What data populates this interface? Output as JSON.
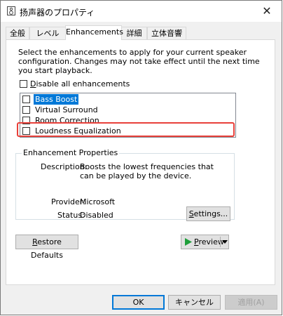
{
  "window": {
    "title": "扬声器のプロパティ",
    "close_glyph": "✕"
  },
  "tabs": [
    {
      "label": "全般"
    },
    {
      "label": "レベル"
    },
    {
      "label": "Enhancements"
    },
    {
      "label": "詳細"
    },
    {
      "label": "立体音響"
    }
  ],
  "active_tab": "Enhancements",
  "enhancements": {
    "description": "Select the enhancements to apply for your current speaker configuration. Changes may not take effect until the next time you start playback.",
    "disable_all_label": "Disable all enhancements",
    "disable_all_checked": false,
    "items": [
      {
        "label": "Bass Boost",
        "checked": false,
        "selected": true
      },
      {
        "label": "Virtual Surround",
        "checked": false,
        "selected": false
      },
      {
        "label": "Room Correction",
        "checked": false,
        "selected": false
      },
      {
        "label": "Loudness Equalization",
        "checked": false,
        "selected": false
      }
    ],
    "highlighted_item": "Loudness Equalization",
    "highlight_color": "#e8403a"
  },
  "properties": {
    "group_title": "Enhancement Properties",
    "description_label": "Description:",
    "description_value": "Boosts the lowest frequencies that can be played by the device.",
    "provider_label": "Provider:",
    "provider_value": "Microsoft",
    "status_label": "Status:",
    "status_value": "Disabled",
    "settings_button": "Settings..."
  },
  "buttons": {
    "restore_defaults": "Restore Defaults",
    "preview": "Preview",
    "ok": "OK",
    "cancel": "キャンセル",
    "apply": "適用(A)"
  },
  "colors": {
    "selection": "#0078d7",
    "play_icon": "#1e9e3a"
  }
}
